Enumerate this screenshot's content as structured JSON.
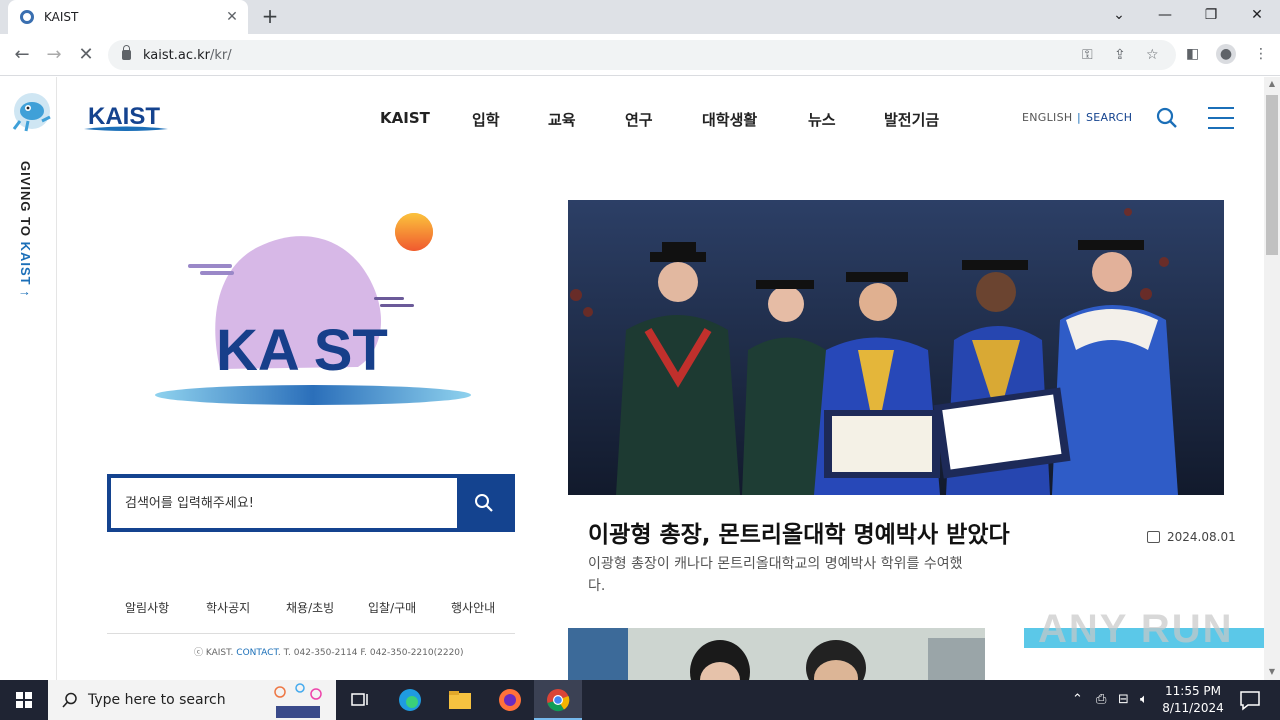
{
  "browser": {
    "tab_title": "KAIST",
    "url_host": "kaist.ac.kr",
    "url_path": "/kr/"
  },
  "sidebar": {
    "vertical_text_a": "GIVING TO",
    "vertical_text_b": "KAIST"
  },
  "header": {
    "logo": "KAIST",
    "nav": [
      "KAIST",
      "입학",
      "교육",
      "연구",
      "대학생활",
      "뉴스",
      "발전기금"
    ],
    "english": "ENGLISH",
    "separator": "|",
    "search": "SEARCH"
  },
  "illustration": {
    "text": "KA ST"
  },
  "search": {
    "placeholder": "검색어를 입력해주세요!"
  },
  "quick_links": [
    "알림사항",
    "학사공지",
    "채용/초빙",
    "입찰/구매",
    "행사안내"
  ],
  "footer": {
    "prefix": "ⓒ KAIST. ",
    "contact": "CONTACT",
    "phones": ". T. 042-350-2114 F. 042-350-2210(2220)"
  },
  "news": {
    "headline": "이광형 총장, 몬트리올대학 명예박사 받았다",
    "date": "2024.08.01",
    "description": "이광형 총장이 캐나다 몬트리올대학교의 명예박사 학위를 수여했다."
  },
  "watermark": "ANY RUN",
  "taskbar": {
    "search_placeholder": "Type here to search",
    "time": "11:55 PM",
    "date": "8/11/2024"
  },
  "colors": {
    "brand": "#14438f",
    "accent": "#1b6fb8"
  }
}
